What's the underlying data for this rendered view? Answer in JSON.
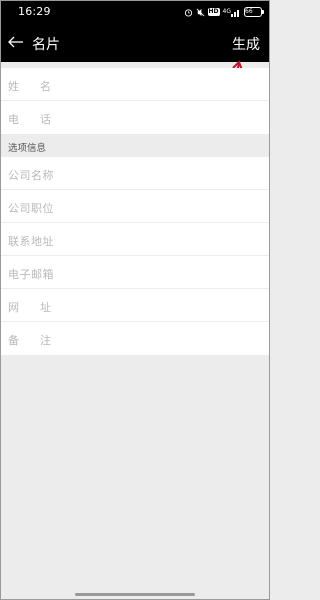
{
  "status_bar": {
    "time": "16:29",
    "network": "4G",
    "hd": "HD",
    "battery": "66"
  },
  "header": {
    "title": "名片",
    "action": "生成"
  },
  "fields": [
    {
      "label": "姓名"
    },
    {
      "label": "电话"
    }
  ],
  "optional_section": {
    "title": "选项信息",
    "fields": [
      {
        "label": "公司名称"
      },
      {
        "label": "公司职位"
      },
      {
        "label": "联系地址"
      },
      {
        "label": "电子邮箱"
      },
      {
        "label": "网址"
      },
      {
        "label": "备注"
      }
    ]
  },
  "colors": {
    "header_bg": "#000000",
    "annotation_arrow": "#c8102e",
    "placeholder": "#b9b9b9",
    "background": "#ececec"
  }
}
